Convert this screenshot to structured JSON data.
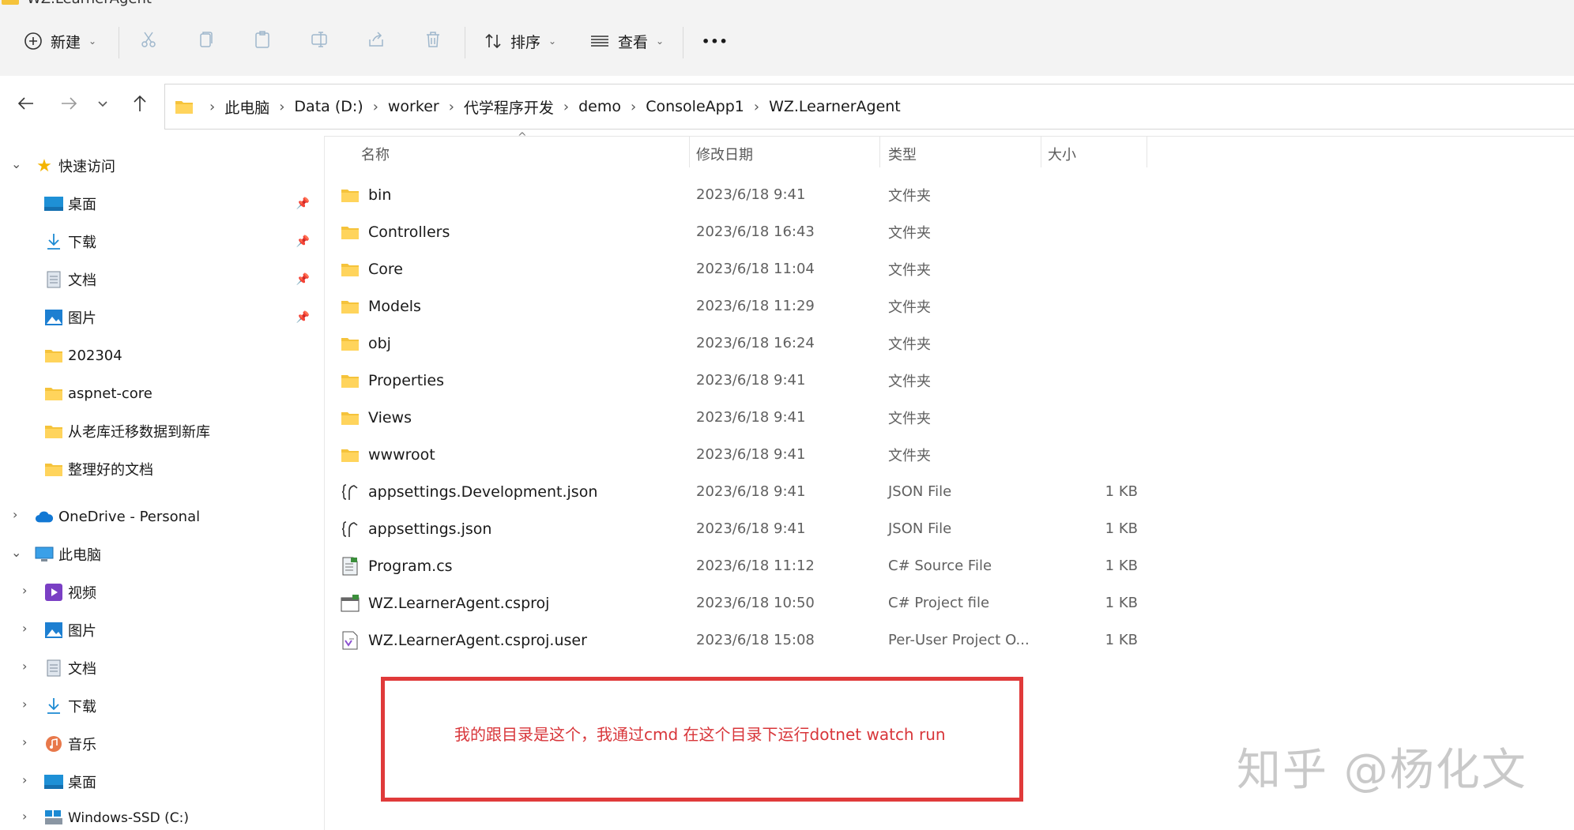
{
  "window": {
    "title": "WZ.LearnerAgent"
  },
  "toolbar": {
    "new_label": "新建",
    "sort_label": "排序",
    "view_label": "查看",
    "more_label": "•••"
  },
  "breadcrumb": [
    "此电脑",
    "Data (D:)",
    "worker",
    "代学程序开发",
    "demo",
    "ConsoleApp1",
    "WZ.LearnerAgent"
  ],
  "sidebar": {
    "quick_access": "快速访问",
    "quick_items": [
      "桌面",
      "下载",
      "文档",
      "图片",
      "202304",
      "aspnet-core",
      "从老库迁移数据到新库",
      "整理好的文档"
    ],
    "onedrive": "OneDrive - Personal",
    "this_pc": "此电脑",
    "pc_items": [
      "视频",
      "图片",
      "文档",
      "下载",
      "音乐",
      "桌面",
      "Windows-SSD (C:)"
    ]
  },
  "columns": {
    "name": "名称",
    "date": "修改日期",
    "type": "类型",
    "size": "大小"
  },
  "files": [
    {
      "name": "bin",
      "date": "2023/6/18 9:41",
      "type": "文件夹",
      "size": "",
      "icon": "folder-icon"
    },
    {
      "name": "Controllers",
      "date": "2023/6/18 16:43",
      "type": "文件夹",
      "size": "",
      "icon": "folder-icon"
    },
    {
      "name": "Core",
      "date": "2023/6/18 11:04",
      "type": "文件夹",
      "size": "",
      "icon": "folder-icon"
    },
    {
      "name": "Models",
      "date": "2023/6/18 11:29",
      "type": "文件夹",
      "size": "",
      "icon": "folder-icon"
    },
    {
      "name": "obj",
      "date": "2023/6/18 16:24",
      "type": "文件夹",
      "size": "",
      "icon": "folder-icon"
    },
    {
      "name": "Properties",
      "date": "2023/6/18 9:41",
      "type": "文件夹",
      "size": "",
      "icon": "folder-icon"
    },
    {
      "name": "Views",
      "date": "2023/6/18 9:41",
      "type": "文件夹",
      "size": "",
      "icon": "folder-icon"
    },
    {
      "name": "wwwroot",
      "date": "2023/6/18 9:41",
      "type": "文件夹",
      "size": "",
      "icon": "folder-icon"
    },
    {
      "name": "appsettings.Development.json",
      "date": "2023/6/18 9:41",
      "type": "JSON File",
      "size": "1 KB",
      "icon": "json-file-icon"
    },
    {
      "name": "appsettings.json",
      "date": "2023/6/18 9:41",
      "type": "JSON File",
      "size": "1 KB",
      "icon": "json-file-icon"
    },
    {
      "name": "Program.cs",
      "date": "2023/6/18 11:12",
      "type": "C# Source File",
      "size": "1 KB",
      "icon": "cs-file-icon"
    },
    {
      "name": "WZ.LearnerAgent.csproj",
      "date": "2023/6/18 10:50",
      "type": "C# Project file",
      "size": "1 KB",
      "icon": "csproj-file-icon"
    },
    {
      "name": "WZ.LearnerAgent.csproj.user",
      "date": "2023/6/18 15:08",
      "type": "Per-User Project O...",
      "size": "1 KB",
      "icon": "user-file-icon"
    }
  ],
  "annotation": "我的跟目录是这个，我通过cmd 在这个目录下运行dotnet watch run",
  "watermark": "知乎 @杨化文",
  "colors": {
    "folder": "#f5c33b",
    "annotation_border": "#e03a3a",
    "annotation_text": "#d8363a",
    "star": "#f4b400"
  }
}
